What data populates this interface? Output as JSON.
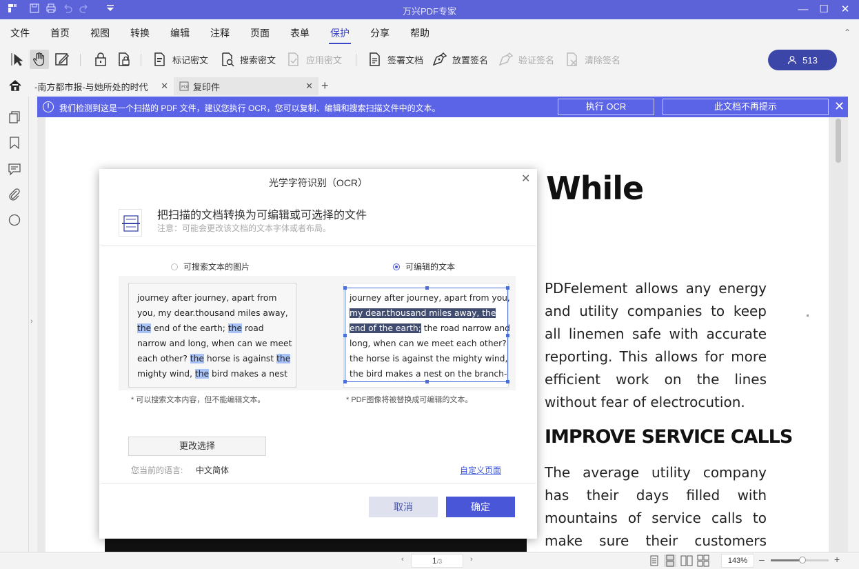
{
  "app": {
    "title": "万兴PDF专家"
  },
  "menu": [
    "文件",
    "首页",
    "视图",
    "转换",
    "编辑",
    "注释",
    "页面",
    "表单",
    "保护",
    "分享",
    "帮助"
  ],
  "menu_active": "保护",
  "toolbar": {
    "mark_redact": "标记密文",
    "search_redact": "搜索密文",
    "apply_redact": "应用密文",
    "sign_doc": "签署文档",
    "place_sign": "放置签名",
    "verify_sign": "验证签名",
    "clear_sign": "清除签名",
    "user_count": "513"
  },
  "tabs": [
    {
      "label": "-南方都市报-与她所处的时代"
    },
    {
      "label": "复印件"
    }
  ],
  "banner": {
    "message": "我们检测到这是一个扫描的 PDF 文件，建议您执行 OCR，您可以复制、编辑和搜索扫描文件中的文本。",
    "ocr_button": "执行 OCR",
    "dismiss_button": "此文档不再提示"
  },
  "document": {
    "heading_fragment": "While",
    "paragraph1": "PDFelement allows any energy and utility companies to keep all linemen safe with accurate reporting. This allows for more efficient work on the lines without fear of electrocution.",
    "subheading": "IMPROVE SERVICE CALLS",
    "paragraph2": "The average utility company has their days filled with mountains of service calls to make sure their customers have the"
  },
  "status": {
    "page_current": "1",
    "page_total": "/3",
    "zoom": "143%",
    "zoom_level": 0.55
  },
  "dialog": {
    "title": "光学字符识别（OCR）",
    "heading": "把扫描的文档转换为可编辑或可选择的文件",
    "note": "注意：可能会更改该文档的文本字体或者布局。",
    "option_searchable": "可搜索文本的图片",
    "option_editable": "可编辑的文本",
    "note_searchable": "* 可以搜索文本内容，但不能编辑文本。",
    "note_editable": "* PDF图像将被替换成可编辑的文本。",
    "change_button": "更改选择",
    "language_label": "您当前的语言:",
    "language_value": "中文简体",
    "custom_page": "自定义页面",
    "cancel": "取消",
    "ok": "确定",
    "preview_left": {
      "l1": "journey after journey, apart from",
      "l2": "you, my dear.thousand miles away,",
      "l3a": "the",
      "l3b": " end of the earth; ",
      "l3c": "the",
      "l3d": " road",
      "l4": "narrow and long, when can we meet",
      "l5a": "each other? ",
      "l5b": "the",
      "l5c": " horse is against ",
      "l5d": "the",
      "l6a": "mighty wind, ",
      "l6b": "the",
      "l6c": " bird makes a nest"
    },
    "preview_right": {
      "l1": "journey after journey, apart from you,",
      "l2": "my dear.thousand miles away, the",
      "l3a": "end of the earth;",
      "l3b": " the road narrow and",
      "l4": "long, when can we meet each other?",
      "l5": "the horse is against the mighty wind,",
      "l6": "the bird makes a nest on the branch-"
    }
  }
}
